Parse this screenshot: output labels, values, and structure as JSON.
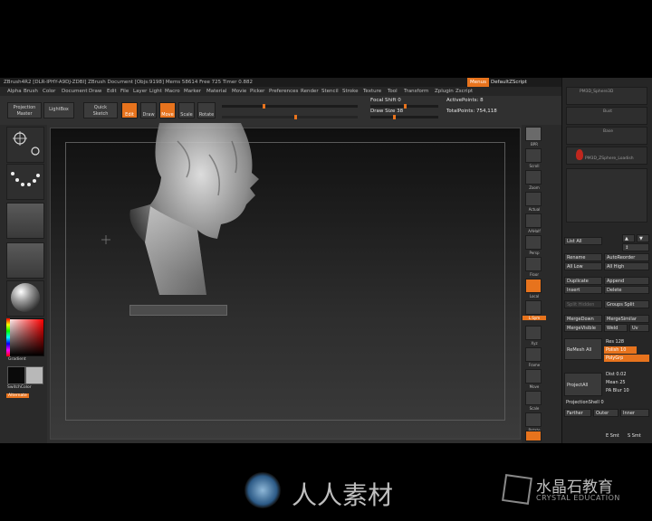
{
  "app": {
    "title_left": "ZBrush4R2  [DLR-IPHY-A9DJ-ZDBI]   ZBrush Document   [Objs:9198]  Mems 58614   Free 725  Timer 0.882",
    "menus_label": "Menus",
    "script_label": "DefaultZScript"
  },
  "menubar": [
    "Alpha",
    "Brush",
    "Color",
    "Document",
    "Draw",
    "Edit",
    "File",
    "Layer",
    "Light",
    "Macro",
    "Marker",
    "Material",
    "Movie",
    "Picker",
    "Preferences",
    "Render",
    "Stencil",
    "Stroke",
    "Texture",
    "Tool",
    "Transform",
    "Zplugin",
    "Zscript"
  ],
  "toolbar": {
    "projection_master": "Projection\nMaster",
    "lightbox": "LightBox",
    "quick_sketch": "Quick\nSketch",
    "edit": "Edit",
    "draw": "Draw",
    "move": "Move",
    "scale": "Scale",
    "rotate": "Rotate",
    "focal_shift": "Focal Shift 0",
    "draw_size": "Draw Size 38",
    "active_points": "ActivePoints: 8",
    "total_points": "TotalPoints: 754,118"
  },
  "lefttray": {
    "gradient": "Gradient",
    "switchcolor": "SwitchColor",
    "alternate": "Alternate"
  },
  "rightcol": [
    "BPR",
    "Scroll",
    "Zoom",
    "Actual",
    "AAHalf",
    "Persp",
    "Floor",
    "Local",
    "L.Sym",
    "Xyz",
    "Frame",
    "Move",
    "Scale",
    "Rotate",
    "PolyF",
    ""
  ],
  "rpanel": {
    "subtools": [
      "PM3D_Sphere3D",
      "Bust",
      "Base",
      "PM3D_ZSphere_Loadish"
    ],
    "list_all": "List All",
    "rename": "Rename",
    "autoreorder": "AutoReorder",
    "all_low": "All Low",
    "all_high": "All High",
    "duplicate": "Duplicate",
    "append": "Append",
    "insert": "Insert",
    "delete": "Delete",
    "split_hidden": "Split Hidden",
    "groups_split": "Groups Split",
    "mergedown": "MergeDown",
    "mergesimilar": "MergeSimilar",
    "mergevisible": "MergeVisible",
    "weld": "Weld",
    "uv": "Uv",
    "remesh_all": "ReMesh All",
    "res": "Res 128",
    "polish": "Polish 10",
    "polygrp": "PolyGrp",
    "project_all": "ProjectAll",
    "dist": "Dist 0.02",
    "mean": "Mean 25",
    "pa_blur": "PA Blur 10",
    "projection_shell": "ProjectionShell 0",
    "farther": "Farther",
    "outer": "Outer",
    "inner": "Inner",
    "e_smt": "E Smt",
    "s_smt": "S Smt"
  },
  "watermark": {
    "cn_left": "人人素材",
    "cn_right": "水晶石教育",
    "en_right": "CRYSTAL EDUCATION"
  },
  "colors": {
    "accent": "#e7731d",
    "panel": "#2f2f2f",
    "canvas_top": "#101010"
  }
}
